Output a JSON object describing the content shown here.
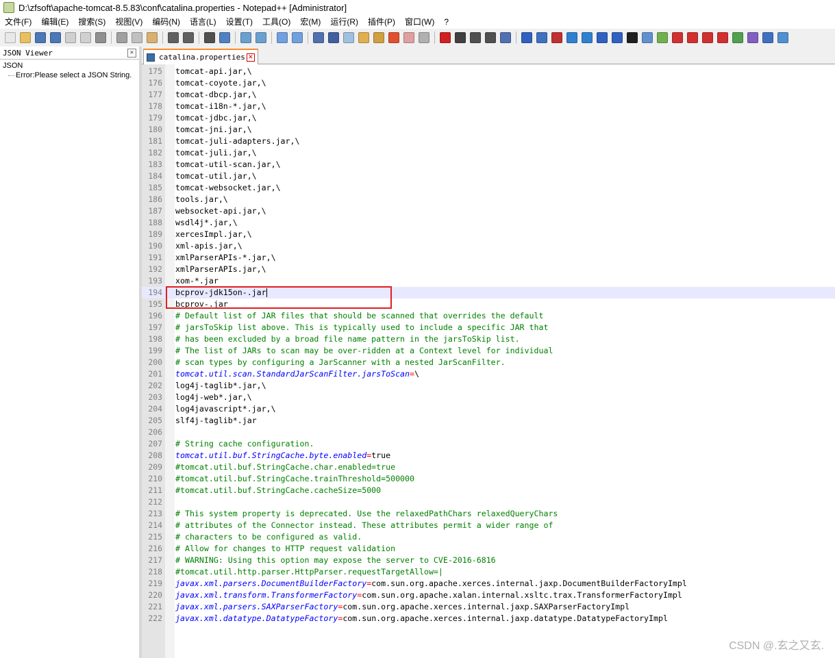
{
  "window": {
    "title": "D:\\zfsoft\\apache-tomcat-8.5.83\\conf\\catalina.properties - Notepad++ [Administrator]"
  },
  "menu": [
    "文件(F)",
    "编辑(E)",
    "搜索(S)",
    "视图(V)",
    "编码(N)",
    "语言(L)",
    "设置(T)",
    "工具(O)",
    "宏(M)",
    "运行(R)",
    "插件(P)",
    "窗口(W)",
    "?"
  ],
  "left_panel": {
    "title": "JSON Viewer",
    "close": "✕",
    "root": "JSON",
    "child": "Error:Please select a JSON String."
  },
  "tab": {
    "label": "catalina.properties",
    "close": "✕"
  },
  "editor": {
    "current_line": 194,
    "lines": [
      {
        "n": "175",
        "t": "tomcat-api.jar,\\"
      },
      {
        "n": "176",
        "t": "tomcat-coyote.jar,\\"
      },
      {
        "n": "177",
        "t": "tomcat-dbcp.jar,\\"
      },
      {
        "n": "178",
        "t": "tomcat-i18n-*.jar,\\"
      },
      {
        "n": "179",
        "t": "tomcat-jdbc.jar,\\"
      },
      {
        "n": "180",
        "t": "tomcat-jni.jar,\\"
      },
      {
        "n": "181",
        "t": "tomcat-juli-adapters.jar,\\"
      },
      {
        "n": "182",
        "t": "tomcat-juli.jar,\\"
      },
      {
        "n": "183",
        "t": "tomcat-util-scan.jar,\\"
      },
      {
        "n": "184",
        "t": "tomcat-util.jar,\\"
      },
      {
        "n": "185",
        "t": "tomcat-websocket.jar,\\"
      },
      {
        "n": "186",
        "t": "tools.jar,\\"
      },
      {
        "n": "187",
        "t": "websocket-api.jar,\\"
      },
      {
        "n": "188",
        "t": "wsdl4j*.jar,\\"
      },
      {
        "n": "189",
        "t": "xercesImpl.jar,\\"
      },
      {
        "n": "190",
        "t": "xml-apis.jar,\\"
      },
      {
        "n": "191",
        "t": "xmlParserAPIs-*.jar,\\"
      },
      {
        "n": "192",
        "t": "xmlParserAPIs.jar,\\"
      },
      {
        "n": "193",
        "t": "xom-*.jar"
      },
      {
        "n": "194",
        "t": "bcprov-jdk15on-.jar"
      },
      {
        "n": "195",
        "t": "bcprov-.jar"
      },
      {
        "n": "196",
        "c": "# Default list of JAR files that should be scanned that overrides the default"
      },
      {
        "n": "197",
        "c": "# jarsToSkip list above. This is typically used to include a specific JAR that"
      },
      {
        "n": "198",
        "c": "# has been excluded by a broad file name pattern in the jarsToSkip list."
      },
      {
        "n": "199",
        "c": "# The list of JARs to scan may be over-ridden at a Context level for individual"
      },
      {
        "n": "200",
        "c": "# scan types by configuring a JarScanner with a nested JarScanFilter."
      },
      {
        "n": "201",
        "k": "tomcat.util.scan.StandardJarScanFilter.jarsToScan",
        "v": "\\"
      },
      {
        "n": "202",
        "t": "log4j-taglib*.jar,\\"
      },
      {
        "n": "203",
        "t": "log4j-web*.jar,\\"
      },
      {
        "n": "204",
        "t": "log4javascript*.jar,\\"
      },
      {
        "n": "205",
        "t": "slf4j-taglib*.jar"
      },
      {
        "n": "206",
        "t": ""
      },
      {
        "n": "207",
        "c": "# String cache configuration."
      },
      {
        "n": "208",
        "k": "tomcat.util.buf.StringCache.byte.enabled",
        "v": "true"
      },
      {
        "n": "209",
        "c": "#tomcat.util.buf.StringCache.char.enabled=true"
      },
      {
        "n": "210",
        "c": "#tomcat.util.buf.StringCache.trainThreshold=500000"
      },
      {
        "n": "211",
        "c": "#tomcat.util.buf.StringCache.cacheSize=5000"
      },
      {
        "n": "212",
        "t": ""
      },
      {
        "n": "213",
        "c": "# This system property is deprecated. Use the relaxedPathChars relaxedQueryChars"
      },
      {
        "n": "214",
        "c": "# attributes of the Connector instead. These attributes permit a wider range of"
      },
      {
        "n": "215",
        "c": "# characters to be configured as valid."
      },
      {
        "n": "216",
        "c": "# Allow for changes to HTTP request validation"
      },
      {
        "n": "217",
        "c": "# WARNING: Using this option may expose the server to CVE-2016-6816"
      },
      {
        "n": "218",
        "c": "#tomcat.util.http.parser.HttpParser.requestTargetAllow=|"
      },
      {
        "n": "219",
        "k": "javax.xml.parsers.DocumentBuilderFactory",
        "v": "com.sun.org.apache.xerces.internal.jaxp.DocumentBuilderFactoryImpl"
      },
      {
        "n": "220",
        "k": "javax.xml.transform.TransformerFactory",
        "v": "com.sun.org.apache.xalan.internal.xsltc.trax.TransformerFactoryImpl"
      },
      {
        "n": "221",
        "k": "javax.xml.parsers.SAXParserFactory",
        "v": "com.sun.org.apache.xerces.internal.jaxp.SAXParserFactoryImpl"
      },
      {
        "n": "222",
        "k": "javax.xml.datatype.DatatypeFactory",
        "v": "com.sun.org.apache.xerces.internal.jaxp.datatype.DatatypeFactoryImpl"
      }
    ]
  },
  "watermark": "CSDN @.玄之又玄.",
  "toolbar": {
    "buttons": [
      {
        "name": "new-file-icon",
        "color": "#e8e8e8"
      },
      {
        "name": "open-file-icon",
        "color": "#e8c060"
      },
      {
        "name": "save-icon",
        "color": "#4a78b8"
      },
      {
        "name": "save-all-icon",
        "color": "#4a78b8"
      },
      {
        "name": "close-icon",
        "color": "#d0d0d0"
      },
      {
        "name": "close-all-icon",
        "color": "#d0d0d0"
      },
      {
        "name": "print-icon",
        "color": "#909090"
      },
      {
        "sep": true
      },
      {
        "name": "cut-icon",
        "color": "#a0a0a0"
      },
      {
        "name": "copy-icon",
        "color": "#c0c0c0"
      },
      {
        "name": "paste-icon",
        "color": "#d8b070"
      },
      {
        "sep": true
      },
      {
        "name": "undo-icon",
        "color": "#606060"
      },
      {
        "name": "redo-icon",
        "color": "#606060"
      },
      {
        "sep": true
      },
      {
        "name": "find-icon",
        "color": "#505050"
      },
      {
        "name": "replace-icon",
        "color": "#5080c0"
      },
      {
        "sep": true
      },
      {
        "name": "zoom-in-icon",
        "color": "#6aa0d0"
      },
      {
        "name": "zoom-out-icon",
        "color": "#6aa0d0"
      },
      {
        "sep": true
      },
      {
        "name": "sync-v-icon",
        "color": "#70a0e0"
      },
      {
        "name": "sync-h-icon",
        "color": "#70a0e0"
      },
      {
        "sep": true
      },
      {
        "name": "wrap-icon",
        "color": "#5070b0"
      },
      {
        "name": "show-all-icon",
        "color": "#4060a0"
      },
      {
        "name": "indent-guide-icon",
        "color": "#a0c0e0"
      },
      {
        "name": "udl-icon",
        "color": "#e0b050"
      },
      {
        "name": "doc-map-icon",
        "color": "#d0a040"
      },
      {
        "name": "function-list-icon",
        "color": "#e05030"
      },
      {
        "name": "folder-workspace-icon",
        "color": "#e0a0a0"
      },
      {
        "name": "monitor-icon",
        "color": "#b0b0b0"
      },
      {
        "sep": true
      },
      {
        "name": "record-icon",
        "color": "#d02020"
      },
      {
        "name": "stop-icon",
        "color": "#404040"
      },
      {
        "name": "play-icon",
        "color": "#505050"
      },
      {
        "name": "play-multiple-icon",
        "color": "#505050"
      },
      {
        "name": "save-macro-icon",
        "color": "#5070b0"
      },
      {
        "sep": true
      },
      {
        "name": "plugin-a-icon",
        "color": "#3060c0"
      },
      {
        "name": "plugin-b-icon",
        "color": "#4070c0"
      },
      {
        "name": "plugin-c-icon",
        "color": "#c03030"
      },
      {
        "name": "plugin-d-icon",
        "color": "#3080d0"
      },
      {
        "name": "plugin-e-icon",
        "color": "#3080d0"
      },
      {
        "name": "plugin-f-icon",
        "color": "#3060c0"
      },
      {
        "name": "plugin-g-icon",
        "color": "#3060c0"
      },
      {
        "name": "plugin-h-icon",
        "color": "#202020"
      },
      {
        "name": "plugin-i-icon",
        "color": "#6090d0"
      },
      {
        "name": "plugin-j-icon",
        "color": "#70b050"
      },
      {
        "name": "plugin-k-icon",
        "color": "#d03030"
      },
      {
        "name": "plugin-l-icon",
        "color": "#d03030"
      },
      {
        "name": "plugin-m-icon",
        "color": "#d03030"
      },
      {
        "name": "plugin-n-icon",
        "color": "#d03030"
      },
      {
        "name": "plugin-o-icon",
        "color": "#50a050"
      },
      {
        "name": "plugin-p-icon",
        "color": "#8060c0"
      },
      {
        "name": "plugin-q-icon",
        "color": "#4070c0"
      },
      {
        "name": "plugin-r-icon",
        "color": "#5090d0"
      }
    ]
  }
}
